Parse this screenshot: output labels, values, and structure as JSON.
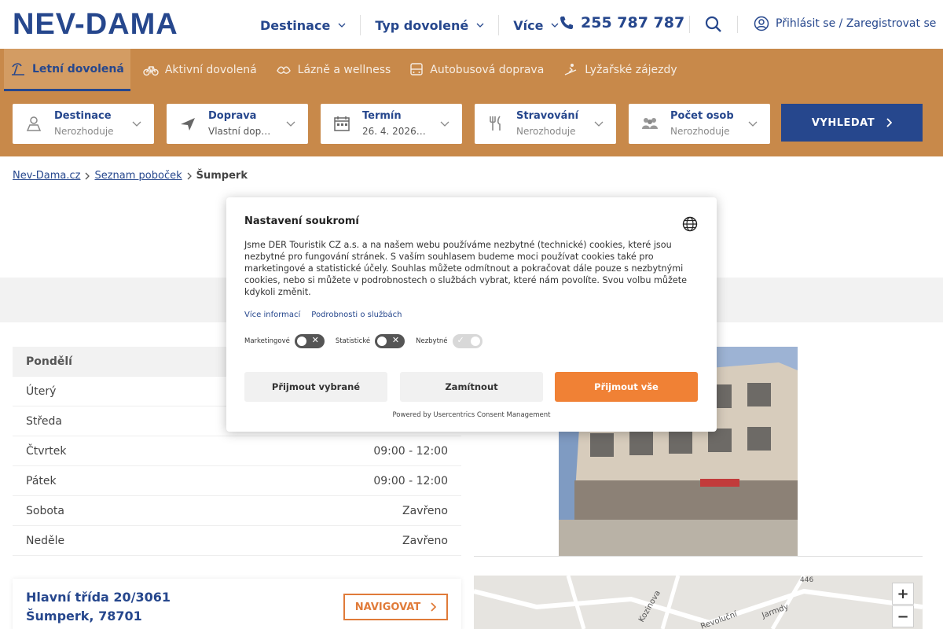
{
  "header": {
    "logo": "NEV-DAMA",
    "nav": [
      "Destinace",
      "Typ dovolené",
      "Více"
    ],
    "phone": "255 787 787",
    "login": "Přihlásit se / Zaregistrovat se"
  },
  "tabs": [
    {
      "label": "Letní dovolená",
      "active": true
    },
    {
      "label": "Aktivní dovolená"
    },
    {
      "label": "Lázně a wellness"
    },
    {
      "label": "Autobusová doprava"
    },
    {
      "label": "Lyžařské zájezdy"
    }
  ],
  "search": {
    "fields": [
      {
        "label": "Destinace",
        "value": "Nerozhoduje"
      },
      {
        "label": "Doprava",
        "value": "Vlastní doprava"
      },
      {
        "label": "Termín",
        "value": "26. 4. 2026 - ..."
      },
      {
        "label": "Stravování",
        "value": "Nerozhoduje"
      },
      {
        "label": "Počet osob",
        "value": "Nerozhoduje"
      }
    ],
    "submit": "VYHLEDAT"
  },
  "breadcrumb": {
    "items": [
      "Nev-Dama.cz",
      "Seznam poboček"
    ],
    "current": "Šumperk"
  },
  "hours": [
    {
      "day": "Pondělí",
      "time": ""
    },
    {
      "day": "Úterý",
      "time": ""
    },
    {
      "day": "Středa",
      "time": ""
    },
    {
      "day": "Čtvrtek",
      "time": "09:00 - 12:00"
    },
    {
      "day": "Pátek",
      "time": "09:00 - 12:00"
    },
    {
      "day": "Sobota",
      "time": "Zavřeno"
    },
    {
      "day": "Neděle",
      "time": "Zavřeno"
    }
  ],
  "address": {
    "line1": "Hlavní třída 20/3061",
    "line2": "Šumperk, 78701",
    "navigate": "NAVIGOVAT"
  },
  "map": {
    "labels": [
      "446",
      "Revoluční",
      "Kozinova",
      "Jarmdy"
    ],
    "zoom_in": "+",
    "zoom_out": "−"
  },
  "consent": {
    "title": "Nastavení soukromí",
    "text": "Jsme DER Touristik CZ a.s. a na našem webu používáme nezbytné (technické) cookies, které jsou nezbytné pro fungování stránek. S vaším souhlasem budeme moci používat cookies také pro marketingové a statistické účely. Souhlas můžete odmítnout a pokračovat dále pouze s nezbytnými cookies, nebo si můžete v podrobnostech o službách vybrat, které nám povolíte. Svou volbu můžete kdykoli změnit.",
    "links": [
      "Více informací",
      "Podrobnosti o službách"
    ],
    "toggles": [
      {
        "label": "Marketingové",
        "on": false
      },
      {
        "label": "Statistické",
        "on": false
      },
      {
        "label": "Nezbytné",
        "on": true
      }
    ],
    "buttons": {
      "accept_selected": "Přijmout vybrané",
      "reject": "Zamítnout",
      "accept_all": "Přijmout vše"
    },
    "powered": "Powered by Usercentrics Consent Management"
  },
  "colors": {
    "brand_blue": "#26478d",
    "orange_bar": "#c8894a",
    "accent_orange": "#f08135"
  }
}
